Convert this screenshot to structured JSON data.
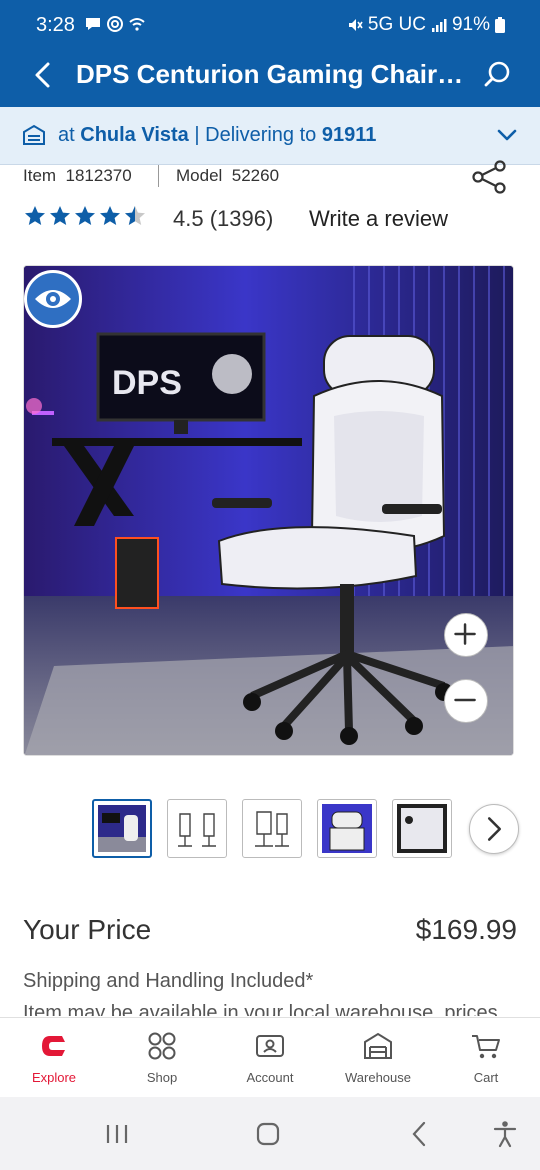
{
  "status_bar": {
    "time": "3:28",
    "network": "5G UC",
    "battery": "91%"
  },
  "header": {
    "title": "DPS Centurion Gaming Chair ...",
    "back_icon": "chevron-left-icon",
    "search_icon": "search-icon"
  },
  "warehouse_bar": {
    "prefix": "at ",
    "warehouse": "Chula Vista",
    "separator": " | Delivering to ",
    "zip": "91911"
  },
  "product": {
    "item_label": "Item",
    "item_number": "1812370",
    "model_label": "Model",
    "model_number": "52260",
    "rating": 4.5,
    "rating_text": "4.5 (1396)",
    "write_review": "Write a review",
    "image_brand_text": "DPS"
  },
  "price": {
    "label": "Your Price",
    "value": "$169.99",
    "shipping": "Shipping and Handling Included*",
    "availability": "Item may be available in your local warehouse, prices"
  },
  "thumbnails": [
    {
      "name": "thumb-room-scene",
      "active": true
    },
    {
      "name": "thumb-dimensions-side",
      "active": false
    },
    {
      "name": "thumb-dimensions-front",
      "active": false
    },
    {
      "name": "thumb-headrest",
      "active": false
    },
    {
      "name": "thumb-backrest-detail",
      "active": false
    }
  ],
  "bottom_nav": [
    {
      "label": "Explore",
      "icon": "costco-logo-icon",
      "active": true
    },
    {
      "label": "Shop",
      "icon": "grid-circles-icon",
      "active": false
    },
    {
      "label": "Account",
      "icon": "account-card-icon",
      "active": false
    },
    {
      "label": "Warehouse",
      "icon": "warehouse-icon",
      "active": false
    },
    {
      "label": "Cart",
      "icon": "cart-icon",
      "active": false
    }
  ],
  "colors": {
    "brand_blue": "#0e5ea8",
    "accent_red": "#e31837",
    "warehouse_bg": "#e4eff9"
  }
}
